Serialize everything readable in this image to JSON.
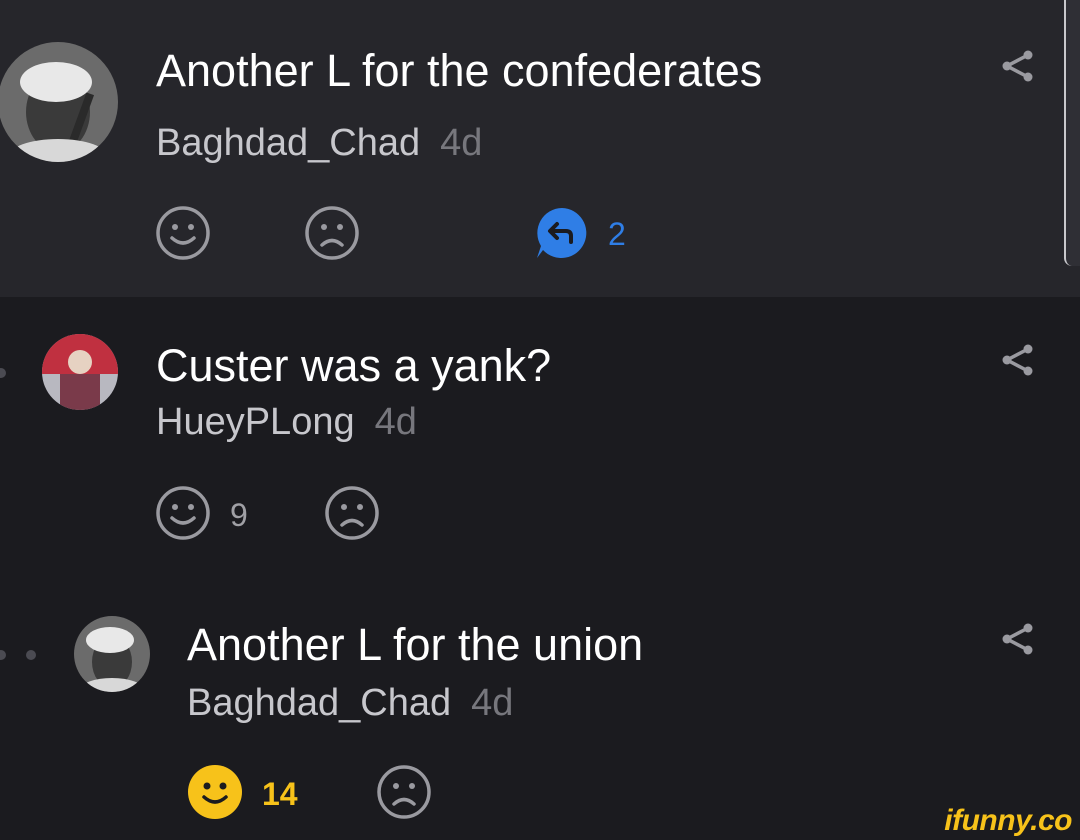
{
  "comments": [
    {
      "text": "Another L for the confederates",
      "user": "Baghdad_Chad",
      "age": "4d",
      "smile_count": "",
      "frown_count": "",
      "replies": "2"
    },
    {
      "text": "Custer was a yank?",
      "user": "HueyPLong",
      "age": "4d",
      "smile_count": "9",
      "frown_count": ""
    },
    {
      "text": "Another L for the union",
      "user": "Baghdad_Chad",
      "age": "4d",
      "smile_count": "14",
      "frown_count": "",
      "smile_active": true
    }
  ],
  "icons": {
    "share": "share-icon",
    "smile": "smile-icon",
    "frown": "frown-icon",
    "reply": "reply-bubble-icon"
  },
  "colors": {
    "accent_yellow": "#f7c21a",
    "accent_blue": "#2f7ee6",
    "icon_gray": "#9a9aa0"
  },
  "watermark": "ifunny.co"
}
